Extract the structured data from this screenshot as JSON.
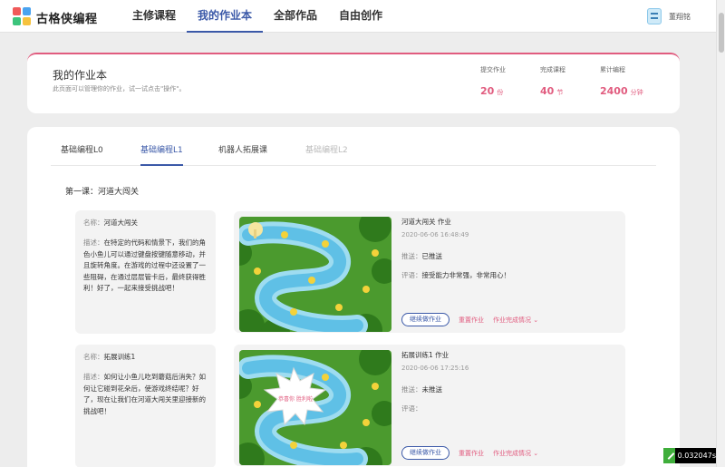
{
  "nav": {
    "logo": "古格侠编程",
    "items": [
      {
        "label": "主修课程"
      },
      {
        "label": "我的作业本"
      },
      {
        "label": "全部作品"
      },
      {
        "label": "自由创作"
      }
    ],
    "active_index": 1,
    "username": "董翔铭"
  },
  "header": {
    "title": "我的作业本",
    "subtitle": "此页面可以管理你的作业，试一试点击\"操作\"。",
    "stats": [
      {
        "label": "提交作业",
        "value": "20",
        "unit": "份"
      },
      {
        "label": "完成课程",
        "value": "40",
        "unit": "节"
      },
      {
        "label": "累计编程",
        "value": "2400",
        "unit": "分钟"
      }
    ]
  },
  "tabs": [
    {
      "label": "基础编程L0",
      "state": "normal"
    },
    {
      "label": "基础编程L1",
      "state": "active"
    },
    {
      "label": "机器人拓展课",
      "state": "normal"
    },
    {
      "label": "基础编程L2",
      "state": "disabled"
    }
  ],
  "lesson": {
    "title": "第一课：河道大闯关"
  },
  "assignments": [
    {
      "name_key": "名称：",
      "name": "河道大闯关",
      "desc_key": "描述：",
      "desc": "在特定的代码和情景下，我们的角色小鱼儿可以通过键盘按键随意移动，并且旋转角度。在游戏的过程中还设置了一些阻碍，在通过层层管卡后，最终获得胜利！好了，一起来接受挑战吧！",
      "work_title": "河道大闯关 作业",
      "time": "2020-06-06 16:48:49",
      "push_key": "推送：",
      "push": "已推送",
      "comment_key": "评语：",
      "comment": "接受能力非常强，非常用心！",
      "has_badge": false
    },
    {
      "name_key": "名称：",
      "name": "拓展训练1",
      "desc_key": "描述：",
      "desc": "如何让小鱼儿吃到蘑菇后消失？如何让它碰到花朵后，使游戏终结呢？好了，现在让我们在河道大闯关里迎接新的挑战吧！",
      "work_title": "拓展训练1 作业",
      "time": "2020-06-06 17:25:16",
      "push_key": "推送：",
      "push": "未推送",
      "comment_key": "评语：",
      "comment": "",
      "has_badge": true,
      "badge_text": "恭喜你 胜利啦"
    }
  ],
  "actions": {
    "continue": "继续做作业",
    "redo": "重置作业",
    "status": "作业完成情况"
  },
  "timer": "0.032047s",
  "colors": {
    "accent": "#3b59a8",
    "pink": "#e15c7f"
  }
}
